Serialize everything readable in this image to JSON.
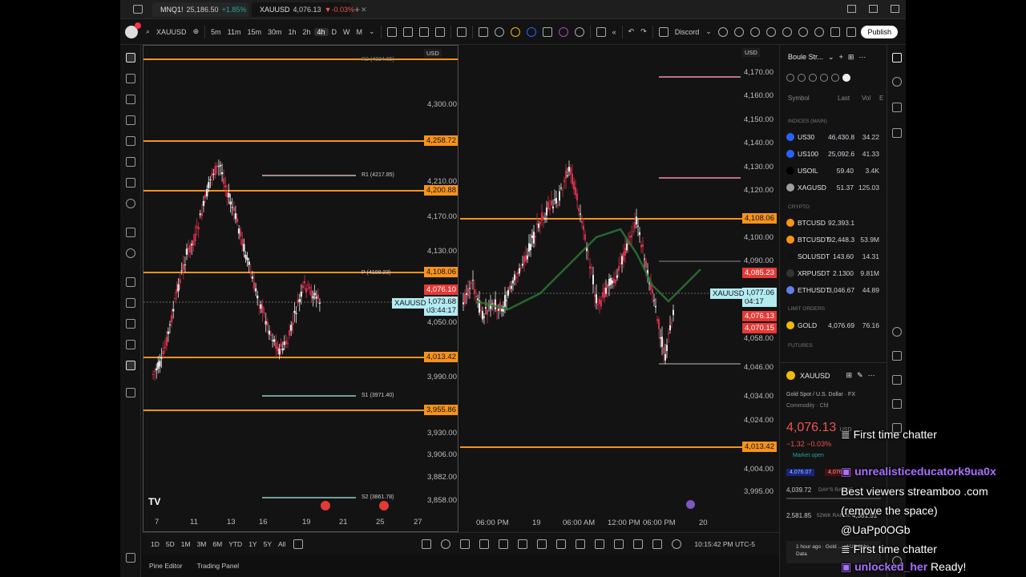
{
  "browser_tabs": [
    {
      "symbol": "MNQ1!",
      "price": "25,186.50",
      "change": "+1.85%"
    },
    {
      "symbol": "XAUUSD",
      "price": "4,076.13",
      "change": "▼-0.03%"
    }
  ],
  "toolbar": {
    "symbol": "XAUUSD",
    "intervals": [
      "5m",
      "11m",
      "15m",
      "30m",
      "1h",
      "2h",
      "4h",
      "D",
      "W",
      "M"
    ],
    "active_interval": "4h",
    "discord_label": "Discord",
    "publish_label": "Publish"
  },
  "left_chart": {
    "currency": "USD",
    "price_labels": [
      "4,300.00",
      "4,210.00",
      "4,170.00",
      "4,130.00",
      "4,050.00",
      "3,990.00",
      "3,930.00",
      "3,906.00",
      "3,882.00",
      "3,858.00"
    ],
    "level_tags": [
      "4,258.72",
      "4,200.88",
      "4,108.06",
      "4,076.10",
      "4,013.42",
      "3,955.86"
    ],
    "pivot_labels": [
      "R2 (4334.65)",
      "R1 (4217.85)",
      "P (4108.23)",
      "S1 (3971.40)",
      "S2 (3861.78)"
    ],
    "symbol_tag": "XAUUSD",
    "last_price": "4,073.68",
    "countdown": "03:44:17",
    "time_labels": [
      "7",
      "11",
      "13",
      "16",
      "19",
      "21",
      "25",
      "27"
    ]
  },
  "right_chart": {
    "currency": "USD",
    "price_labels": [
      "4,170.00",
      "4,160.00",
      "4,150.00",
      "4,140.00",
      "4,130.00",
      "4,120.00",
      "4,100.00",
      "4,090.00",
      "4,058.00",
      "4,046.00",
      "4,034.00",
      "4,024.00",
      "4,004.00",
      "3,995.00"
    ],
    "level_tags": [
      "4,108.06",
      "4,085.23",
      "4,076.13",
      "4,070.15",
      "4,013.42"
    ],
    "symbol_tag": "XAUUSD",
    "last_price": "4,077.06",
    "countdown": "04:17",
    "time_labels": [
      "06:00 PM",
      "19",
      "06:00 AM",
      "12:00 PM",
      "06:00 PM",
      "20"
    ]
  },
  "bottom_ranges": [
    "1D",
    "5D",
    "1M",
    "3M",
    "6M",
    "YTD",
    "1Y",
    "5Y",
    "All"
  ],
  "clock": "10:15:42 PM UTC-5",
  "footer_tabs": [
    "Pine Editor",
    "Trading Panel"
  ],
  "watchlist": {
    "name": "Boule Str...",
    "columns": [
      "Symbol",
      "Last",
      "Vol",
      "E"
    ],
    "sections": [
      "INDICES (MAIN)",
      "CRYPTO",
      "LIMIT ORDERS",
      "FUTURES"
    ],
    "indices": [
      {
        "symbol": "US30",
        "last": "46,430.8",
        "vol": "34.22",
        "color": "#2962ff"
      },
      {
        "symbol": "US100",
        "last": "25,092.6",
        "vol": "41.33",
        "color": "#2962ff"
      },
      {
        "symbol": "USOIL",
        "last": "59.40",
        "vol": "3.4K",
        "color": "#000000"
      },
      {
        "symbol": "XAGUSD",
        "last": "51.37",
        "vol": "125.03",
        "color": "#9e9e9e"
      }
    ],
    "crypto": [
      {
        "symbol": "BTCUSD",
        "last": "92,393.1",
        "vol": "",
        "color": "#f7931a"
      },
      {
        "symbol": "BTCUSDT",
        "last": "92,448.3",
        "vol": "53.9M",
        "color": "#f7931a"
      },
      {
        "symbol": "SOLUSDT",
        "last": "143.60",
        "vol": "14.31",
        "color": "#111111"
      },
      {
        "symbol": "XRPUSDT",
        "last": "2.1300",
        "vol": "9.81M",
        "color": "#333333"
      },
      {
        "symbol": "ETHUSDT",
        "last": "3,046.67",
        "vol": "44.89",
        "color": "#627eea"
      }
    ],
    "limit_orders": [
      {
        "symbol": "GOLD",
        "last": "4,076.69",
        "vol": "76.16",
        "color": "#f0b90b"
      }
    ]
  },
  "detail": {
    "symbol": "XAUUSD",
    "description": "Gold Spot / U.S. Dollar",
    "exchange": "FX",
    "type": "Commodity · Cfd",
    "price": "4,076.13",
    "currency": "USD",
    "change": "−1.32",
    "change_pct": "−0.03%",
    "market_status": "Market open",
    "bid": "4,076.07",
    "ask": "4,076.97",
    "day_low": "4,039.72",
    "day_range_label": "DAY'S RANGE",
    "w52_low": "2,581.85",
    "w52_label": "52WK RANGE",
    "w52_high": "4,381.51",
    "news_time": "1 hour ago",
    "news_text": "Gold ... of US Jobs Data"
  },
  "chat": [
    {
      "type": "badge",
      "text": "First time chatter"
    },
    {
      "type": "user",
      "text": "unrealisticeducatork9ua0x"
    },
    {
      "type": "msg",
      "text": "Best viewers streamboo .com"
    },
    {
      "type": "msg",
      "text": "(remove the space)"
    },
    {
      "type": "msg",
      "text": "@UaPp0OGb"
    },
    {
      "type": "badge",
      "text": "First time chatter"
    },
    {
      "type": "user_msg",
      "user": "unlocked_her",
      "text": "Ready!"
    }
  ],
  "colors": {
    "accent_orange": "#f7931a",
    "up": "#26a69a",
    "down": "#ef5350",
    "twitch_purple": "#a970ff",
    "price_tag_red": "#e53935"
  }
}
